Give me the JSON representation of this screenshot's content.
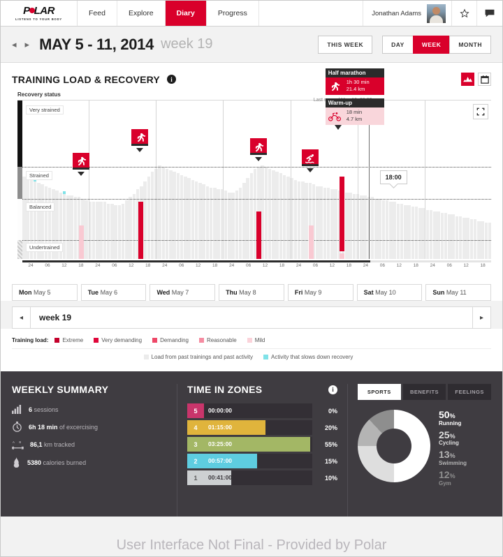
{
  "nav": {
    "brand": "POLAR",
    "brand_tagline": "LISTENS TO YOUR BODY",
    "tabs": [
      {
        "label": "Feed",
        "active": false
      },
      {
        "label": "Explore",
        "active": false
      },
      {
        "label": "Diary",
        "active": true
      },
      {
        "label": "Progress",
        "active": false
      }
    ],
    "user_name": "Jonathan Adams",
    "avatar_name": "user-avatar",
    "star_icon": "star-icon",
    "message_icon": "message-icon"
  },
  "datebar": {
    "prev_arrow": "◂",
    "next_arrow": "▸",
    "title": "MAY 5 - 11, 2014",
    "week": "week 19",
    "this_week": "THIS WEEK",
    "range_options": [
      {
        "label": "DAY",
        "active": false
      },
      {
        "label": "WEEK",
        "active": true
      },
      {
        "label": "MONTH",
        "active": false
      }
    ]
  },
  "chart_card": {
    "title": "TRAINING LOAD & RECOVERY",
    "info_glyph": "i",
    "view_icons": [
      "chart-view-icon",
      "calendar-view-icon"
    ],
    "axis_label": "Recovery status",
    "last_synced": "Last synced May 10, 08:03",
    "time_bubble": "18:00",
    "expand_icon": "expand-icon"
  },
  "chart_data": {
    "type": "bar",
    "title": "Training Load & Recovery",
    "ylabel": "Recovery status",
    "xlabel": "",
    "zones": [
      "Very strained",
      "Strained",
      "Balanced",
      "Undertrained"
    ],
    "zone_boundaries_pct": [
      0,
      42,
      62,
      88
    ],
    "hour_ticks": [
      "24",
      "06",
      "12",
      "18",
      "24",
      "06",
      "12",
      "18",
      "24",
      "06",
      "12",
      "18",
      "24",
      "06",
      "12",
      "18",
      "24",
      "06",
      "12",
      "18",
      "24",
      "06",
      "12",
      "18",
      "24",
      "06",
      "12",
      "18"
    ],
    "grid": true,
    "legend_position": "bottom",
    "values": [
      52,
      51,
      50,
      49,
      48,
      47,
      46,
      45,
      44,
      43,
      42,
      41,
      40,
      40,
      39,
      39,
      38,
      37,
      36,
      36,
      36,
      36,
      36,
      35,
      35,
      34,
      34,
      35,
      37,
      39,
      41,
      44,
      46,
      49,
      52,
      55,
      57,
      59,
      58,
      57,
      56,
      55,
      54,
      53,
      52,
      51,
      50,
      49,
      48,
      47,
      46,
      45,
      45,
      44,
      44,
      43,
      42,
      42,
      43,
      45,
      48,
      51,
      54,
      57,
      58,
      59,
      58,
      57,
      56,
      55,
      54,
      53,
      52,
      51,
      50,
      49,
      49,
      48,
      48,
      47,
      46,
      46,
      45,
      45,
      44,
      44,
      43,
      43,
      42,
      42,
      41,
      41,
      40,
      40,
      39,
      39,
      38,
      38,
      37,
      37,
      36,
      36,
      35,
      35,
      34,
      34,
      33,
      33,
      32,
      32,
      31,
      31,
      30,
      30,
      29,
      29,
      28,
      28,
      27,
      27,
      26,
      26,
      25,
      25,
      24,
      24,
      23,
      23
    ],
    "past_activity_markers_pct": [
      1,
      3,
      11
    ],
    "activities": [
      {
        "label": "Running",
        "icon": "running-icon",
        "x_pct": 13.5,
        "load": "Reasonable"
      },
      {
        "label": "Running",
        "icon": "running-icon",
        "x_pct": 26.0,
        "load": "Very demanding"
      },
      {
        "label": "Running",
        "icon": "running-icon",
        "x_pct": 51.0,
        "load": "Very demanding"
      },
      {
        "label": "Swimming",
        "icon": "swimming-icon",
        "x_pct": 62.0,
        "load": "Reasonable"
      },
      {
        "label": "Half marathon",
        "icon": "running-icon",
        "x_pct": 68.5,
        "load": "Extreme"
      }
    ],
    "tooltips": [
      {
        "title": "Half marathon",
        "icon": "running-icon",
        "duration": "1h 30 min",
        "distance": "21.4 km",
        "style": "red"
      },
      {
        "title": "Warm-up",
        "icon": "cycling-icon",
        "duration": "18 min",
        "distance": "4.7 km",
        "style": "pink"
      }
    ]
  },
  "days": [
    {
      "dow": "Mon",
      "date": "May 5"
    },
    {
      "dow": "Tue",
      "date": "May 6"
    },
    {
      "dow": "Wed",
      "date": "May 7"
    },
    {
      "dow": "Thu",
      "date": "May 8"
    },
    {
      "dow": "Fri",
      "date": "May 9"
    },
    {
      "dow": "Sat",
      "date": "May 10"
    },
    {
      "dow": "Sun",
      "date": "May 11"
    }
  ],
  "weeknav": {
    "prev": "◂",
    "next": "▸",
    "label": "week 19"
  },
  "legend": {
    "title": "Training load:",
    "items": [
      {
        "label": "Extreme",
        "color": "#c4002b"
      },
      {
        "label": "Very demanding",
        "color": "#e0063a"
      },
      {
        "label": "Demanding",
        "color": "#ee4868"
      },
      {
        "label": "Reasonable",
        "color": "#f58ca1"
      },
      {
        "label": "Mild",
        "color": "#fbd3da"
      }
    ],
    "secondary": [
      {
        "label": "Load from past trainings and past activity",
        "color": "#ebebeb"
      },
      {
        "label": "Activity that slows down recovery",
        "color": "#7fe2e8"
      }
    ]
  },
  "weekly_summary": {
    "title": "WEEKLY SUMMARY",
    "rows": [
      {
        "icon": "bars-icon",
        "value": "6",
        "label": " sessions"
      },
      {
        "icon": "stopwatch-icon",
        "value": "6h 18 min",
        "label": " of excercising"
      },
      {
        "icon": "distance-icon",
        "value": "86,1",
        "label": " km tracked"
      },
      {
        "icon": "flame-icon",
        "value": "5380",
        "label": " calories burned"
      }
    ]
  },
  "time_in_zones": {
    "title": "TIME IN ZONES",
    "info_glyph": "i",
    "zones": [
      {
        "zone": "5",
        "time": "00:00:00",
        "pct": "0%",
        "fill": 0,
        "color": "#c9356b"
      },
      {
        "zone": "4",
        "time": "01:15:00",
        "pct": "20%",
        "fill": 57,
        "color": "#e0b43c"
      },
      {
        "zone": "3",
        "time": "03:25:00",
        "pct": "55%",
        "fill": 98,
        "color": "#a3b765"
      },
      {
        "zone": "2",
        "time": "00:57:00",
        "pct": "15%",
        "fill": 49,
        "color": "#5ecde0"
      },
      {
        "zone": "1",
        "time": "00:41:00",
        "pct": "10%",
        "fill": 25,
        "color": "#cdd0d2"
      }
    ]
  },
  "sports": {
    "tabs": [
      {
        "label": "SPORTS",
        "active": true
      },
      {
        "label": "BENEFITS",
        "active": false
      },
      {
        "label": "FEELINGS",
        "active": false
      }
    ],
    "chart_type": "pie",
    "items": [
      {
        "pct": "50",
        "unit": "%",
        "name": "Running",
        "value": 50,
        "color": "#ffffff",
        "text_color": "#ffffff"
      },
      {
        "pct": "25",
        "unit": "%",
        "name": "Cycling",
        "value": 25,
        "color": "#dedede",
        "text_color": "#dedede"
      },
      {
        "pct": "13",
        "unit": "%",
        "name": "Swimming",
        "value": 13,
        "color": "#b4b4b4",
        "text_color": "#b4b4b4"
      },
      {
        "pct": "12",
        "unit": "%",
        "name": "Gym",
        "value": 12,
        "color": "#8e8e8e",
        "text_color": "#8e8e8e"
      }
    ]
  },
  "watermark": "User Interface Not Final - Provided by Polar"
}
